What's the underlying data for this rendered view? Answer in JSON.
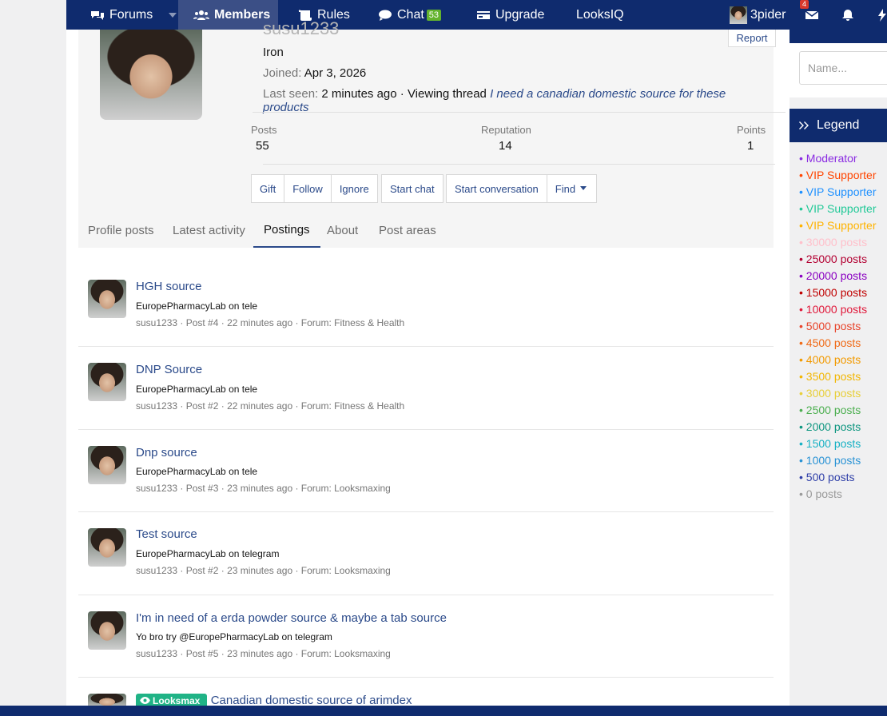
{
  "nav": {
    "items": [
      {
        "label": "Forums"
      },
      {
        "label": "Members"
      },
      {
        "label": "Rules"
      },
      {
        "label": "Chat",
        "badge": "53"
      },
      {
        "label": "Upgrade"
      },
      {
        "label": "LooksIQ"
      }
    ],
    "username": "3pider",
    "notif_count": "4"
  },
  "profile": {
    "username_partial": "susu1233",
    "rank": "Iron",
    "joined_label": "Joined:",
    "joined_value": "Apr 3, 2026",
    "last_seen_label": "Last seen:",
    "last_seen_value": "2 minutes ago · Viewing thread ",
    "last_seen_thread": "I need a canadian domestic source for these products",
    "report": "Report",
    "stats": [
      {
        "label": "Posts",
        "value": "55"
      },
      {
        "label": "Reputation",
        "value": "14"
      },
      {
        "label": "Points",
        "value": "1"
      }
    ],
    "buttons": {
      "gift": "Gift",
      "follow": "Follow",
      "ignore": "Ignore",
      "start_chat": "Start chat",
      "start_conversation": "Start conversation",
      "find": "Find"
    }
  },
  "tabs": [
    "Profile posts",
    "Latest activity",
    "Postings",
    "About",
    "Post areas"
  ],
  "posts": [
    {
      "title": "HGH source",
      "snippet": "EuropePharmacyLab on tele",
      "user": "susu1233",
      "meta": " · Post #4 · 22 minutes ago · Forum: Fitness & Health"
    },
    {
      "title": "DNP Source",
      "snippet": "EuropePharmacyLab on tele",
      "user": "susu1233",
      "meta": " · Post #2 · 22 minutes ago · Forum: Fitness & Health"
    },
    {
      "title": "Dnp source",
      "snippet": "EuropePharmacyLab on tele",
      "user": "susu1233",
      "meta": " · Post #3 · 23 minutes ago · Forum: Looksmaxing"
    },
    {
      "title": "Test source",
      "snippet": "EuropePharmacyLab on telegram",
      "user": "susu1233",
      "meta": " · Post #2 · 23 minutes ago · Forum: Looksmaxing"
    },
    {
      "title": "I'm in need of a erda powder source & maybe a tab source",
      "snippet": "Yo bro try @EuropePharmacyLab on telegram",
      "user": "susu1233",
      "meta": " · Post #5 · 23 minutes ago · Forum: Looksmaxing"
    },
    {
      "prefix": "Looksmax",
      "title": "Canadian domestic source of arimdex"
    }
  ],
  "sidebar": {
    "find_placeholder": "Name...",
    "legend_title": "Legend",
    "legend": [
      {
        "label": "• Moderator",
        "color": "#8a2be2"
      },
      {
        "label": "• VIP Supporter",
        "color": "#ff4500"
      },
      {
        "label": "• VIP Supporter",
        "color": "#1e90ff"
      },
      {
        "label": "• VIP Supporter",
        "color": "#20c997"
      },
      {
        "label": "• VIP Supporter",
        "color": "#ffb300"
      },
      {
        "label": "• 30000 posts",
        "color": "#ffc0cb"
      },
      {
        "label": "• 25000 posts",
        "color": "#b30032"
      },
      {
        "label": "• 20000 posts",
        "color": "#8a00c2"
      },
      {
        "label": "• 15000 posts",
        "color": "#c00000"
      },
      {
        "label": "• 10000 posts",
        "color": "#e0193b"
      },
      {
        "label": "• 5000 posts",
        "color": "#e8452c"
      },
      {
        "label": "• 4500 posts",
        "color": "#f06a16"
      },
      {
        "label": "• 4000 posts",
        "color": "#f29a00"
      },
      {
        "label": "• 3500 posts",
        "color": "#f2b705"
      },
      {
        "label": "• 3000 posts",
        "color": "#e8cf3a"
      },
      {
        "label": "• 2500 posts",
        "color": "#4caf50"
      },
      {
        "label": "• 2000 posts",
        "color": "#0e9680"
      },
      {
        "label": "• 1500 posts",
        "color": "#17b1c4"
      },
      {
        "label": "• 1000 posts",
        "color": "#2a93d5"
      },
      {
        "label": "• 500 posts",
        "color": "#2f3fa8"
      },
      {
        "label": "• 0 posts",
        "color": "#9a9a9a"
      }
    ]
  }
}
